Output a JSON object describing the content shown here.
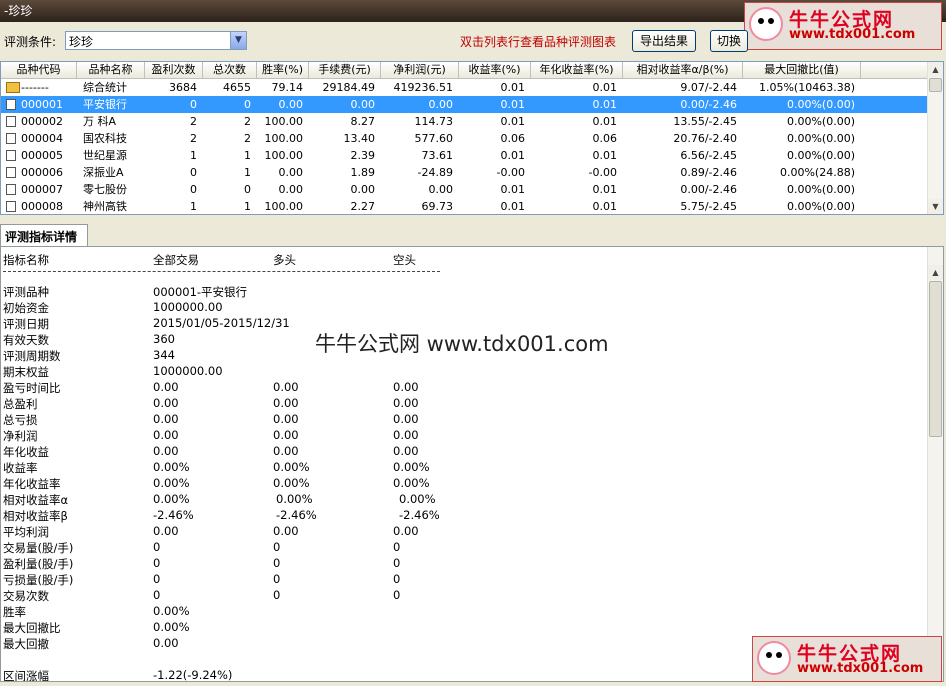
{
  "window": {
    "title": "-珍珍"
  },
  "watermark_logo": {
    "line1": "牛牛公式网",
    "line2": "www.tdx001.com"
  },
  "toolbar": {
    "condition_label": "评测条件:",
    "condition_value": "珍珍",
    "hint": "双击列表行查看品种评测图表",
    "export_label": "导出结果",
    "switch_label": "切换"
  },
  "grid": {
    "headers": [
      "品种代码",
      "品种名称",
      "盈利次数",
      "总次数",
      "胜率(%)",
      "手续费(元)",
      "净利润(元)",
      "收益率(%)",
      "年化收益率(%)",
      "相对收益率α/β(%)",
      "最大回撤比(值)"
    ],
    "rows": [
      {
        "icon": "folder",
        "code": "-------",
        "name": "综合统计",
        "wins": "3684",
        "total": "4655",
        "winrate": "79.14",
        "fee": "29184.49",
        "profit": "419236.51",
        "ret": "0.01",
        "annual": "0.01",
        "rel": "9.07/-2.44",
        "maxdd": "1.05%(10463.38)"
      },
      {
        "icon": "doc",
        "code": "000001",
        "name": "平安银行",
        "wins": "0",
        "total": "0",
        "winrate": "0.00",
        "fee": "0.00",
        "profit": "0.00",
        "ret": "0.01",
        "annual": "0.01",
        "rel": "0.00/-2.46",
        "maxdd": "0.00%(0.00)"
      },
      {
        "icon": "doc",
        "code": "000002",
        "name": "万 科A",
        "wins": "2",
        "total": "2",
        "winrate": "100.00",
        "fee": "8.27",
        "profit": "114.73",
        "ret": "0.01",
        "annual": "0.01",
        "rel": "13.55/-2.45",
        "maxdd": "0.00%(0.00)"
      },
      {
        "icon": "doc",
        "code": "000004",
        "name": "国农科技",
        "wins": "2",
        "total": "2",
        "winrate": "100.00",
        "fee": "13.40",
        "profit": "577.60",
        "ret": "0.06",
        "annual": "0.06",
        "rel": "20.76/-2.40",
        "maxdd": "0.00%(0.00)"
      },
      {
        "icon": "doc",
        "code": "000005",
        "name": "世纪星源",
        "wins": "1",
        "total": "1",
        "winrate": "100.00",
        "fee": "2.39",
        "profit": "73.61",
        "ret": "0.01",
        "annual": "0.01",
        "rel": "6.56/-2.45",
        "maxdd": "0.00%(0.00)"
      },
      {
        "icon": "doc",
        "code": "000006",
        "name": "深振业A",
        "wins": "0",
        "total": "1",
        "winrate": "0.00",
        "fee": "1.89",
        "profit": "-24.89",
        "ret": "-0.00",
        "annual": "-0.00",
        "rel": "0.89/-2.46",
        "maxdd": "0.00%(24.88)"
      },
      {
        "icon": "doc",
        "code": "000007",
        "name": "零七股份",
        "wins": "0",
        "total": "0",
        "winrate": "0.00",
        "fee": "0.00",
        "profit": "0.00",
        "ret": "0.01",
        "annual": "0.01",
        "rel": "0.00/-2.46",
        "maxdd": "0.00%(0.00)"
      },
      {
        "icon": "doc",
        "code": "000008",
        "name": "神州高铁",
        "wins": "1",
        "total": "1",
        "winrate": "100.00",
        "fee": "2.27",
        "profit": "69.73",
        "ret": "0.01",
        "annual": "0.01",
        "rel": "5.75/-2.45",
        "maxdd": "0.00%(0.00)"
      }
    ],
    "selected_row": 1
  },
  "detail": {
    "tab_label": "评测指标详情",
    "col_headers": [
      "指标名称",
      "全部交易",
      "多头",
      "空头"
    ],
    "rows": [
      [
        "评测品种",
        "000001-平安银行",
        "",
        ""
      ],
      [
        "初始资金",
        "1000000.00",
        "",
        ""
      ],
      [
        "评测日期",
        "2015/01/05-2015/12/31",
        "",
        ""
      ],
      [
        "有效天数",
        "360",
        "",
        ""
      ],
      [
        "评测周期数",
        "344",
        "",
        ""
      ],
      [
        "期末权益",
        "1000000.00",
        "",
        ""
      ],
      [
        "盈亏时间比",
        "0.00",
        "0.00",
        "0.00"
      ],
      [
        "总盈利",
        "0.00",
        "0.00",
        "0.00"
      ],
      [
        "总亏损",
        "0.00",
        "0.00",
        "0.00"
      ],
      [
        "净利润",
        "0.00",
        "0.00",
        "0.00"
      ],
      [
        "年化收益",
        "0.00",
        "0.00",
        "0.00"
      ],
      [
        "收益率",
        "0.00%",
        "0.00%",
        "0.00%"
      ],
      [
        "年化收益率",
        "0.00%",
        "0.00%",
        "0.00%"
      ],
      [
        "相对收益率α",
        "0.00%",
        "0.00%",
        "0.00%"
      ],
      [
        "相对收益率β",
        "-2.46%",
        "-2.46%",
        "-2.46%"
      ],
      [
        "平均利润",
        "0.00",
        "0.00",
        "0.00"
      ],
      [
        "交易量(股/手)",
        "0",
        "0",
        "0"
      ],
      [
        "盈利量(股/手)",
        "0",
        "0",
        "0"
      ],
      [
        "亏损量(股/手)",
        "0",
        "0",
        "0"
      ],
      [
        "交易次数",
        "0",
        "0",
        "0"
      ],
      [
        "胜率",
        "0.00%",
        "",
        ""
      ],
      [
        "最大回撤比",
        "0.00%",
        "",
        ""
      ],
      [
        "最大回撤",
        "0.00",
        "",
        ""
      ],
      [
        "",
        "",
        " ",
        ""
      ],
      [
        "区间涨幅",
        "-1.22(-9.24%)",
        "",
        ""
      ]
    ],
    "watermark": "牛牛公式网 www.tdx001.com"
  }
}
